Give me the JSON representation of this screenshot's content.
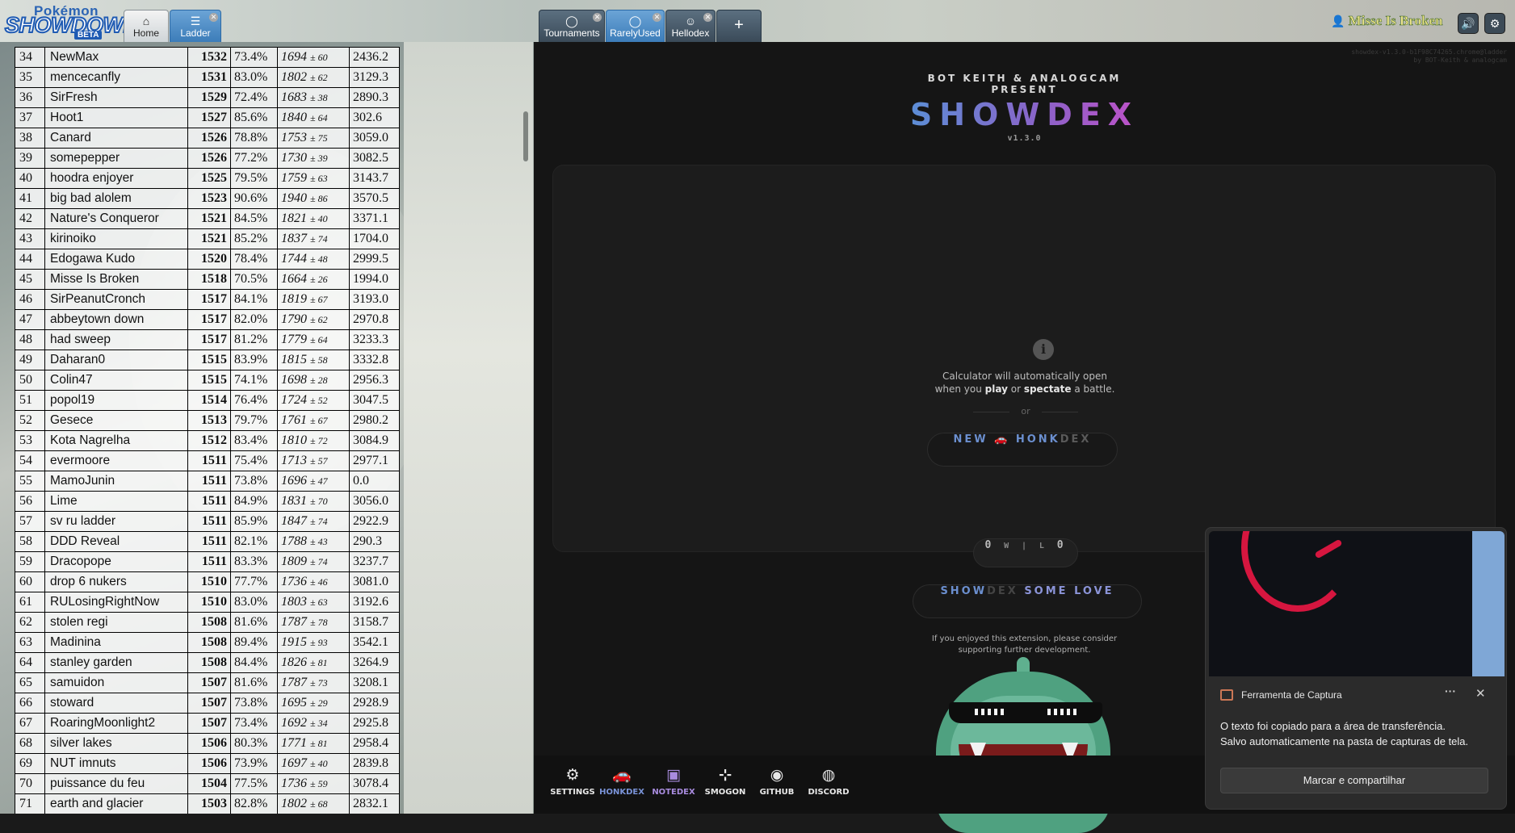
{
  "header": {
    "logo": {
      "line1": "Pokémon",
      "line2": "SHOWDOWN!",
      "badge": "BETA"
    },
    "tabs_left": [
      {
        "label": "Home",
        "icon": "home-icon"
      },
      {
        "label": "Ladder",
        "icon": "list-icon"
      }
    ],
    "tabs_center": [
      {
        "label": "Tournaments",
        "icon": "chat-icon"
      },
      {
        "label": "RarelyUsed",
        "icon": "chat-icon"
      },
      {
        "label": "Hellodex",
        "icon": "smiley-icon"
      }
    ],
    "new_tab": "+",
    "username": "Misse Is Broken"
  },
  "ladder": {
    "rows": [
      {
        "rank": "34",
        "name": "NewMax",
        "elo": "1532",
        "gxe": "73.4%",
        "glicko": "1694",
        "dev": "± 60",
        "coil": "2436.2"
      },
      {
        "rank": "35",
        "name": "mencecanfly",
        "elo": "1531",
        "gxe": "83.0%",
        "glicko": "1802",
        "dev": "± 62",
        "coil": "3129.3"
      },
      {
        "rank": "36",
        "name": "SirFresh",
        "elo": "1529",
        "gxe": "72.4%",
        "glicko": "1683",
        "dev": "± 38",
        "coil": "2890.3"
      },
      {
        "rank": "37",
        "name": "Hoot1",
        "elo": "1527",
        "gxe": "85.6%",
        "glicko": "1840",
        "dev": "± 64",
        "coil": "302.6"
      },
      {
        "rank": "38",
        "name": "Canard",
        "elo": "1526",
        "gxe": "78.8%",
        "glicko": "1753",
        "dev": "± 75",
        "coil": "3059.0"
      },
      {
        "rank": "39",
        "name": "somepepper",
        "elo": "1526",
        "gxe": "77.2%",
        "glicko": "1730",
        "dev": "± 39",
        "coil": "3082.5"
      },
      {
        "rank": "40",
        "name": "hoodra enjoyer",
        "elo": "1525",
        "gxe": "79.5%",
        "glicko": "1759",
        "dev": "± 63",
        "coil": "3143.7"
      },
      {
        "rank": "41",
        "name": "big bad alolem",
        "elo": "1523",
        "gxe": "90.6%",
        "glicko": "1940",
        "dev": "± 86",
        "coil": "3570.5"
      },
      {
        "rank": "42",
        "name": "Nature's Conqueror",
        "elo": "1521",
        "gxe": "84.5%",
        "glicko": "1821",
        "dev": "± 40",
        "coil": "3371.1"
      },
      {
        "rank": "43",
        "name": "kirinoiko",
        "elo": "1521",
        "gxe": "85.2%",
        "glicko": "1837",
        "dev": "± 74",
        "coil": "1704.0"
      },
      {
        "rank": "44",
        "name": "Edogawa Kudo",
        "elo": "1520",
        "gxe": "78.4%",
        "glicko": "1744",
        "dev": "± 48",
        "coil": "2999.5"
      },
      {
        "rank": "45",
        "name": "Misse Is Broken",
        "elo": "1518",
        "gxe": "70.5%",
        "glicko": "1664",
        "dev": "± 26",
        "coil": "1994.0"
      },
      {
        "rank": "46",
        "name": "SirPeanutCronch",
        "elo": "1517",
        "gxe": "84.1%",
        "glicko": "1819",
        "dev": "± 67",
        "coil": "3193.0"
      },
      {
        "rank": "47",
        "name": "abbeytown down",
        "elo": "1517",
        "gxe": "82.0%",
        "glicko": "1790",
        "dev": "± 62",
        "coil": "2970.8"
      },
      {
        "rank": "48",
        "name": "had sweep",
        "elo": "1517",
        "gxe": "81.2%",
        "glicko": "1779",
        "dev": "± 64",
        "coil": "3233.3"
      },
      {
        "rank": "49",
        "name": "Daharan0",
        "elo": "1515",
        "gxe": "83.9%",
        "glicko": "1815",
        "dev": "± 58",
        "coil": "3332.8"
      },
      {
        "rank": "50",
        "name": "Colin47",
        "elo": "1515",
        "gxe": "74.1%",
        "glicko": "1698",
        "dev": "± 28",
        "coil": "2956.3"
      },
      {
        "rank": "51",
        "name": "popol19",
        "elo": "1514",
        "gxe": "76.4%",
        "glicko": "1724",
        "dev": "± 52",
        "coil": "3047.5"
      },
      {
        "rank": "52",
        "name": "Gesece",
        "elo": "1513",
        "gxe": "79.7%",
        "glicko": "1761",
        "dev": "± 67",
        "coil": "2980.2"
      },
      {
        "rank": "53",
        "name": "Kota Nagrelha",
        "elo": "1512",
        "gxe": "83.4%",
        "glicko": "1810",
        "dev": "± 72",
        "coil": "3084.9"
      },
      {
        "rank": "54",
        "name": "evermoore",
        "elo": "1511",
        "gxe": "75.4%",
        "glicko": "1713",
        "dev": "± 57",
        "coil": "2977.1"
      },
      {
        "rank": "55",
        "name": "MamoJunin",
        "elo": "1511",
        "gxe": "73.8%",
        "glicko": "1696",
        "dev": "± 47",
        "coil": "0.0"
      },
      {
        "rank": "56",
        "name": "Lime",
        "elo": "1511",
        "gxe": "84.9%",
        "glicko": "1831",
        "dev": "± 70",
        "coil": "3056.0"
      },
      {
        "rank": "57",
        "name": "sv ru ladder",
        "elo": "1511",
        "gxe": "85.9%",
        "glicko": "1847",
        "dev": "± 74",
        "coil": "2922.9"
      },
      {
        "rank": "58",
        "name": "DDD Reveal",
        "elo": "1511",
        "gxe": "82.1%",
        "glicko": "1788",
        "dev": "± 43",
        "coil": "290.3"
      },
      {
        "rank": "59",
        "name": "Dracopope",
        "elo": "1511",
        "gxe": "83.3%",
        "glicko": "1809",
        "dev": "± 74",
        "coil": "3237.7"
      },
      {
        "rank": "60",
        "name": "drop 6 nukers",
        "elo": "1510",
        "gxe": "77.7%",
        "glicko": "1736",
        "dev": "± 46",
        "coil": "3081.0"
      },
      {
        "rank": "61",
        "name": "RULosingRightNow",
        "elo": "1510",
        "gxe": "83.0%",
        "glicko": "1803",
        "dev": "± 63",
        "coil": "3192.6"
      },
      {
        "rank": "62",
        "name": "stolen regi",
        "elo": "1508",
        "gxe": "81.6%",
        "glicko": "1787",
        "dev": "± 78",
        "coil": "3158.7"
      },
      {
        "rank": "63",
        "name": "Madinina",
        "elo": "1508",
        "gxe": "89.4%",
        "glicko": "1915",
        "dev": "± 93",
        "coil": "3542.1"
      },
      {
        "rank": "64",
        "name": "stanley garden",
        "elo": "1508",
        "gxe": "84.4%",
        "glicko": "1826",
        "dev": "± 81",
        "coil": "3264.9"
      },
      {
        "rank": "65",
        "name": "samuidon",
        "elo": "1507",
        "gxe": "81.6%",
        "glicko": "1787",
        "dev": "± 73",
        "coil": "3208.1"
      },
      {
        "rank": "66",
        "name": "stoward",
        "elo": "1507",
        "gxe": "73.8%",
        "glicko": "1695",
        "dev": "± 29",
        "coil": "2928.9"
      },
      {
        "rank": "67",
        "name": "RoaringMoonlight2",
        "elo": "1507",
        "gxe": "73.4%",
        "glicko": "1692",
        "dev": "± 34",
        "coil": "2925.8"
      },
      {
        "rank": "68",
        "name": "silver lakes",
        "elo": "1506",
        "gxe": "80.3%",
        "glicko": "1771",
        "dev": "± 81",
        "coil": "2958.4"
      },
      {
        "rank": "69",
        "name": "NUT imnuts",
        "elo": "1506",
        "gxe": "73.9%",
        "glicko": "1697",
        "dev": "± 40",
        "coil": "2839.8"
      },
      {
        "rank": "70",
        "name": "puissance du feu",
        "elo": "1504",
        "gxe": "77.5%",
        "glicko": "1736",
        "dev": "± 59",
        "coil": "3078.4"
      },
      {
        "rank": "71",
        "name": "earth and glacier",
        "elo": "1503",
        "gxe": "82.8%",
        "glicko": "1802",
        "dev": "± 68",
        "coil": "2832.1"
      }
    ]
  },
  "showdex": {
    "corner_line1": "showdex-v1.3.0-b1F98C74265.chrome@ladder",
    "corner_line2": "by BOT-Keith & analogcam",
    "present_line1": "BOT KEITH & ANALOGCAM",
    "present_line2": "PRESENT",
    "title": "SHOWDEX",
    "version": "v1.3.0",
    "calc_line1": "Calculator will automatically open",
    "calc_line2_a": "when you ",
    "calc_line2_play": "play",
    "calc_line2_b": " or ",
    "calc_line2_spectate": "spectate",
    "calc_line2_c": " a battle.",
    "or": "or",
    "new_btn_a": "NEW",
    "new_btn_b": "HONK",
    "new_btn_c": "DEX",
    "wl_w_value": "0",
    "wl_w": "W",
    "wl_l": "L",
    "wl_l_value": "0",
    "love_a": "SHOW",
    "love_b": "DEX",
    "love_c": "SOME LOVE",
    "support_line1": "If you enjoyed this extension, please consider",
    "support_line2": "supporting further development.",
    "nav": [
      {
        "label": "SETTINGS",
        "icon": "gear-icon",
        "glyph": "⚙"
      },
      {
        "label": "HONKDEX",
        "icon": "car-icon",
        "glyph": "🚗"
      },
      {
        "label": "NOTEDEX",
        "icon": "note-icon",
        "glyph": "▣"
      },
      {
        "label": "SMOGON",
        "icon": "signpost-icon",
        "glyph": "⊹"
      },
      {
        "label": "GITHUB",
        "icon": "github-icon",
        "glyph": "◉"
      },
      {
        "label": "DISCORD",
        "icon": "discord-icon",
        "glyph": "◍"
      }
    ]
  },
  "toast": {
    "app_name": "Ferramenta de Captura",
    "more": "···",
    "close": "✕",
    "line1": "O texto foi copiado para a área de transferência.",
    "line2": "Salvo automaticamente na pasta de capturas de tela.",
    "button": "Marcar e compartilhar"
  }
}
